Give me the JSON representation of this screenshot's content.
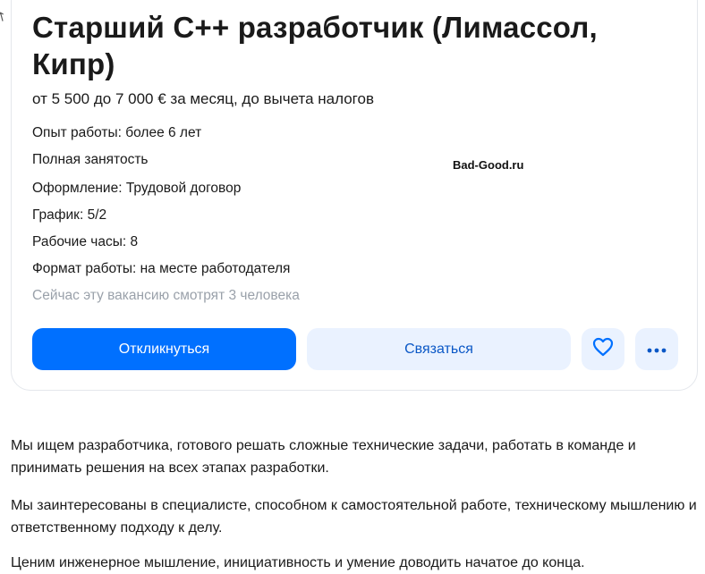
{
  "vacancy": {
    "title": "Старший C++ разработчик (Лимассол, Кипр)",
    "salary": "от 5 500 до 7 000 € за месяц, до вычета налогов",
    "details": [
      "Опыт работы: более 6 лет",
      "Полная занятость",
      "Оформление: Трудовой договор",
      "График: 5/2",
      "Рабочие часы: 8",
      "Формат работы: на месте работодателя"
    ],
    "viewers": "Сейчас эту вакансию смотрят 3 человека"
  },
  "watermark": "Bad-Good.ru",
  "actions": {
    "respond_label": "Откликнуться",
    "contact_label": "Связаться",
    "favorite_icon": "heart-icon",
    "more_icon": "more-dots-icon"
  },
  "description": {
    "paragraphs": [
      "Мы ищем разработчика, готового решать сложные технические задачи, работать в команде и принимать решения на всех этапах разработки.",
      "Мы заинтересованы в специалисте, способном к самостоятельной работе, техническому мышлению и ответственному подходу к делу.",
      "Ценим инженерное мышление, инициативность и умение доводить начатое до конца."
    ]
  },
  "colors": {
    "primary": "#0070ff",
    "secondary_bg": "#eaf2ff",
    "muted_text": "#9aa1aa"
  }
}
